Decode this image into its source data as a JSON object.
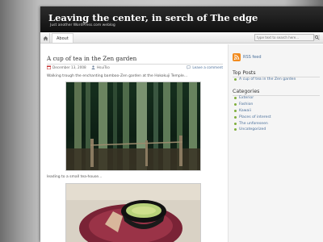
{
  "site": {
    "title": "Leaving the center, in serch of The edge",
    "tagline": "Just another WordPress.com weblog"
  },
  "nav": {
    "home_icon": "home-icon",
    "items": [
      {
        "label": "About"
      }
    ]
  },
  "search": {
    "placeholder": "type text to search here..."
  },
  "post": {
    "title": "A cup of tea in the Zen garden",
    "date": "December 13, 2008",
    "author": "HsuiTso",
    "comment_link": "Leave a comment",
    "intro": "Walking trough the enchanting bamboo-Zen garden at the Hokokuji Temple…",
    "caption": "leading to a small tea-house…"
  },
  "sidebar": {
    "rss_label": "RSS feed",
    "top_posts": {
      "heading": "Top Posts",
      "items": [
        "A cup of tea in the Zen garden"
      ]
    },
    "categories": {
      "heading": "Categories",
      "items": [
        "Exterior",
        "Fashion",
        "Kawaii",
        "Places of interest",
        "The unforeseen",
        "Uncategorized"
      ]
    }
  },
  "colors": {
    "header_bg": "#1a1a1a",
    "link": "#4a6f9a",
    "bullet": "#7fae3c",
    "rss": "#f28a1c"
  }
}
